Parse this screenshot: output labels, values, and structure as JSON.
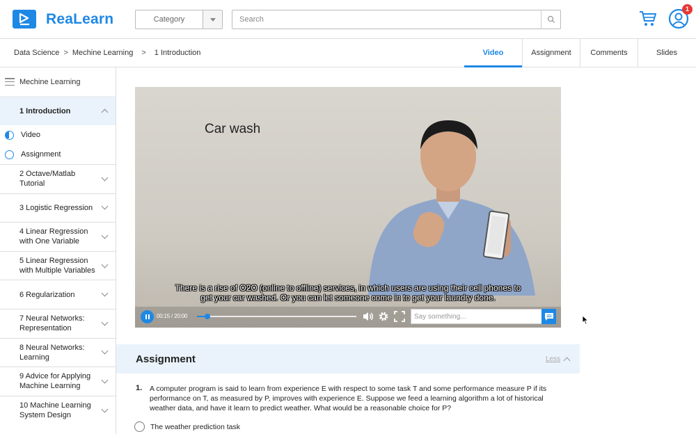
{
  "app": {
    "name": "ReaLearn",
    "brand_color": "#1e88e5"
  },
  "header": {
    "category_label": "Category",
    "search_placeholder": "Search",
    "notification_count": "1"
  },
  "breadcrumb": {
    "items": [
      "Data Science",
      "Mechine Learning",
      "1 Introduction"
    ],
    "separators": [
      ">",
      ">"
    ]
  },
  "tabs": [
    {
      "label": "Video",
      "active": true
    },
    {
      "label": "Assignment",
      "active": false
    },
    {
      "label": "Comments",
      "active": false
    },
    {
      "label": "Slides",
      "active": false
    }
  ],
  "sidebar": {
    "title": "Mechine Learning",
    "active_chapter": "1  Introduction",
    "sub_items": [
      {
        "label": "Video",
        "icon": "progress-half-icon"
      },
      {
        "label": "Assignment",
        "icon": "progress-empty-icon"
      }
    ],
    "chapters": [
      {
        "label": "2   Octave/Matlab Tutorial"
      },
      {
        "label": "3   Logistic Regression"
      },
      {
        "label": "4   Linear Regression with One Variable"
      },
      {
        "label": "5   Linear Regression with Multiple Variables"
      },
      {
        "label": "6   Regularization"
      },
      {
        "label": "7   Neural Networks: Representation"
      },
      {
        "label": "8   Neural Networks: Learning"
      },
      {
        "label": "9   Advice for Applying Machine Learning"
      },
      {
        "label": "10 Machine Learning System Design"
      }
    ]
  },
  "video": {
    "slide_text": "Car wash",
    "subtitle_line1": "There is a rise of O2O (online to offline) services, in which users are using their cell phones to",
    "subtitle_line2": "get your car washed. Or you can let someone come in to get your laundry done.",
    "time": "00:15 / 20:00",
    "progress_fraction": 0.065,
    "comment_placeholder": "Say something..."
  },
  "assignment": {
    "title": "Assignment",
    "toggle_label": "Less",
    "question_number": "1.",
    "question_text": "A computer program is said to learn from experience E with respect to some task T and some performance measure P if its performance on T, as measured by P, improves with experience E. Suppose we feed a learning algorithm a lot of historical weather data, and have it learn to predict weather. What would be a reasonable choice for P?",
    "option_1": "The weather prediction task"
  }
}
